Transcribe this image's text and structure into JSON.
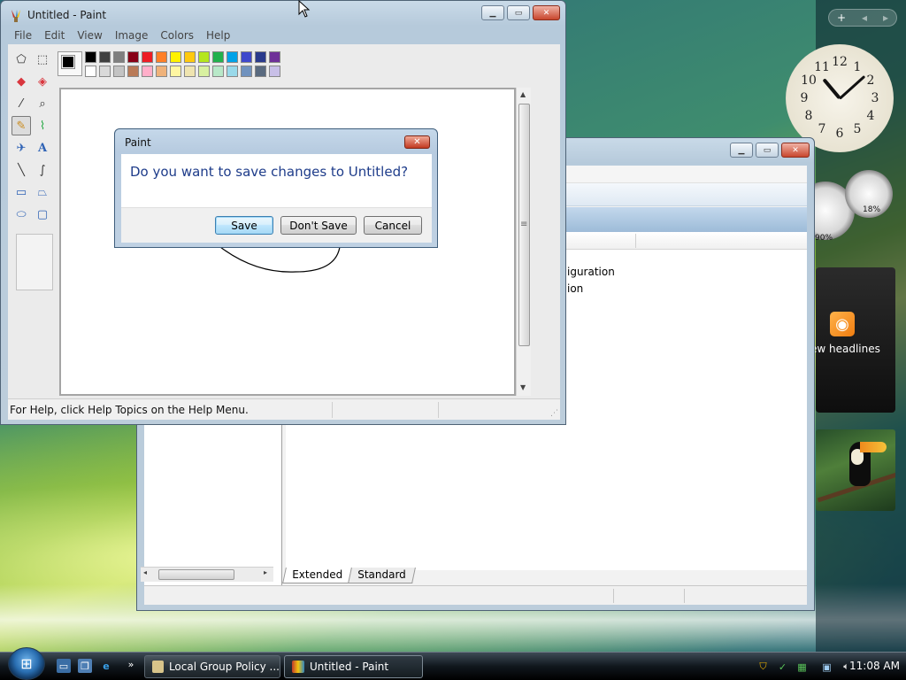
{
  "paint": {
    "title": "Untitled - Paint",
    "menu": [
      "File",
      "Edit",
      "View",
      "Image",
      "Colors",
      "Help"
    ],
    "status": "For Help, click Help Topics on the Help Menu.",
    "palette_top": [
      "#000000",
      "#404040",
      "#7f7f7f",
      "#880015",
      "#ed1c24",
      "#ff7f27",
      "#fff200",
      "#ffc90e",
      "#b5e61d",
      "#22b14c",
      "#00a2e8",
      "#3f48cc",
      "#2a3a8c",
      "#6f3198"
    ],
    "palette_bottom": [
      "#ffffff",
      "#d9d9d9",
      "#c3c3c3",
      "#b97a57",
      "#ffaec9",
      "#efb27a",
      "#fff6a2",
      "#efe4b0",
      "#d8f0a0",
      "#b8e8c8",
      "#99d9ea",
      "#7092be",
      "#5a6a7f",
      "#c8bfe7"
    ]
  },
  "dialog": {
    "title": "Paint",
    "message": "Do you want to save changes to Untitled?",
    "buttons": {
      "save": "Save",
      "dont_save": "Don't Save",
      "cancel": "Cancel"
    }
  },
  "group_policy": {
    "items": [
      "iguration",
      "ion"
    ],
    "tabs": [
      "Extended",
      "Standard"
    ]
  },
  "sidebar": {
    "clock_numbers": [
      "12",
      "1",
      "2",
      "3",
      "4",
      "5",
      "6",
      "7",
      "8",
      "9",
      "10",
      "11"
    ],
    "meter_cpu": "18%",
    "meter_mem": "90%",
    "feed_text": "ew headlines"
  },
  "taskbar": {
    "buttons": [
      "Local Group Policy ...",
      "Untitled - Paint"
    ],
    "time": "11:08 AM"
  }
}
